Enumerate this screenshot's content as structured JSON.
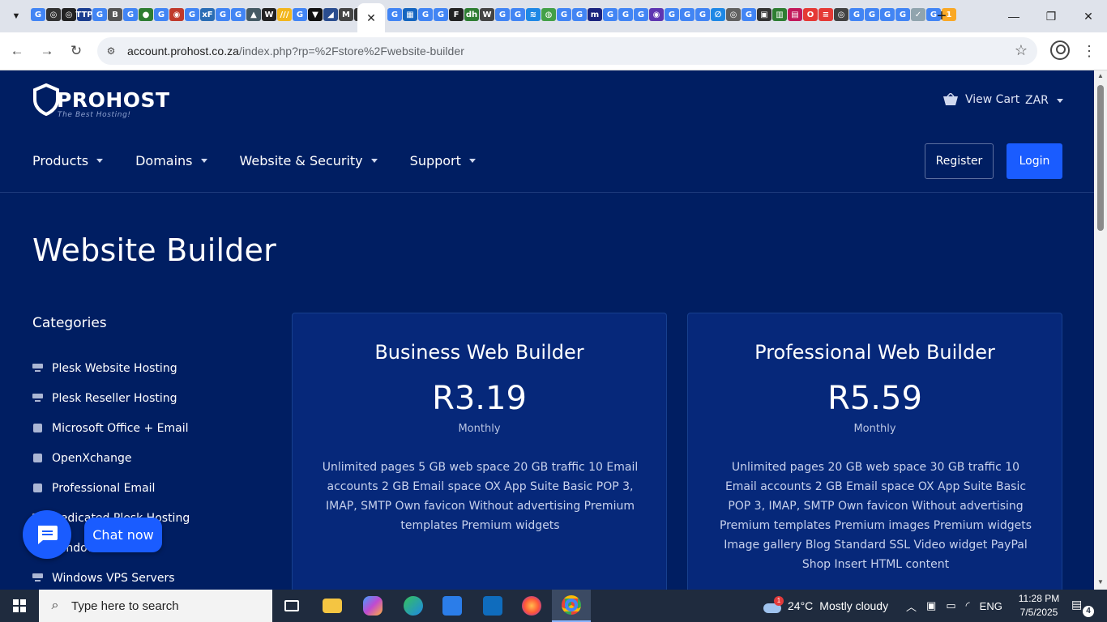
{
  "browser": {
    "url_host": "account.prohost.co.za",
    "url_path": "/index.php?rp=%2Fstore%2Fwebsite-builder",
    "active_tab_close": "✕",
    "new_tab": "+",
    "favicons_left": [
      {
        "label": "G",
        "color": "#4285f4"
      },
      {
        "label": "◎",
        "color": "#333"
      },
      {
        "label": "◎",
        "color": "#222"
      },
      {
        "label": "TTP",
        "color": "#1a3d8f"
      },
      {
        "label": "G",
        "color": "#4285f4"
      },
      {
        "label": "B",
        "color": "#555"
      },
      {
        "label": "G",
        "color": "#4285f4"
      },
      {
        "label": "●",
        "color": "#2e7d32"
      },
      {
        "label": "G",
        "color": "#4285f4"
      },
      {
        "label": "◉",
        "color": "#c0392b"
      },
      {
        "label": "G",
        "color": "#4285f4"
      },
      {
        "label": "xF",
        "color": "#2a6db5"
      },
      {
        "label": "G",
        "color": "#4285f4"
      },
      {
        "label": "G",
        "color": "#4285f4"
      },
      {
        "label": "▲",
        "color": "#455a64"
      },
      {
        "label": "W",
        "color": "#222"
      },
      {
        "label": "///",
        "color": "#f2b61d"
      },
      {
        "label": "G",
        "color": "#4285f4"
      },
      {
        "label": "▼",
        "color": "#111"
      },
      {
        "label": "◢",
        "color": "#2a4d8f"
      },
      {
        "label": "M",
        "color": "#444"
      },
      {
        "label": "◕",
        "color": "#333"
      },
      {
        "label": "e",
        "color": "#6a5acd"
      }
    ],
    "favicons_right": [
      {
        "label": "G",
        "color": "#4285f4"
      },
      {
        "label": "▦",
        "color": "#1565c0"
      },
      {
        "label": "G",
        "color": "#4285f4"
      },
      {
        "label": "G",
        "color": "#4285f4"
      },
      {
        "label": "F",
        "color": "#222"
      },
      {
        "label": "dh",
        "color": "#2e7d32"
      },
      {
        "label": "W",
        "color": "#444"
      },
      {
        "label": "G",
        "color": "#4285f4"
      },
      {
        "label": "G",
        "color": "#4285f4"
      },
      {
        "label": "≋",
        "color": "#1e88e5"
      },
      {
        "label": "◍",
        "color": "#43a047"
      },
      {
        "label": "G",
        "color": "#4285f4"
      },
      {
        "label": "G",
        "color": "#4285f4"
      },
      {
        "label": "m",
        "color": "#1a237e"
      },
      {
        "label": "G",
        "color": "#4285f4"
      },
      {
        "label": "G",
        "color": "#4285f4"
      },
      {
        "label": "G",
        "color": "#4285f4"
      },
      {
        "label": "◉",
        "color": "#5e35b1"
      },
      {
        "label": "G",
        "color": "#4285f4"
      },
      {
        "label": "G",
        "color": "#4285f4"
      },
      {
        "label": "G",
        "color": "#4285f4"
      },
      {
        "label": "∅",
        "color": "#1e88e5"
      },
      {
        "label": "◎",
        "color": "#616161"
      },
      {
        "label": "G",
        "color": "#4285f4"
      },
      {
        "label": "▣",
        "color": "#333"
      },
      {
        "label": "▥",
        "color": "#2e7d32"
      },
      {
        "label": "▤",
        "color": "#c2185b"
      },
      {
        "label": "O",
        "color": "#e53935"
      },
      {
        "label": "≡",
        "color": "#e53935"
      },
      {
        "label": "◎",
        "color": "#424242"
      },
      {
        "label": "G",
        "color": "#4285f4"
      },
      {
        "label": "G",
        "color": "#4285f4"
      },
      {
        "label": "G",
        "color": "#4285f4"
      },
      {
        "label": "G",
        "color": "#4285f4"
      },
      {
        "label": "✓",
        "color": "#90a4ae"
      },
      {
        "label": "G",
        "color": "#4285f4"
      },
      {
        "label": "1",
        "color": "#f9a825"
      }
    ]
  },
  "header": {
    "logo_word": "PROHOST",
    "logo_tagline": "The Best Hosting!",
    "view_cart": "View Cart",
    "currency": "ZAR"
  },
  "nav": {
    "items": [
      "Products",
      "Domains",
      "Website & Security",
      "Support"
    ],
    "register": "Register",
    "login": "Login"
  },
  "main": {
    "title": "Website Builder",
    "categories_heading": "Categories",
    "categories": [
      {
        "label": "Plesk Website Hosting",
        "icon": "server-icon"
      },
      {
        "label": "Plesk Reseller Hosting",
        "icon": "server-icon"
      },
      {
        "label": "Microsoft Office + Email",
        "icon": "box-icon"
      },
      {
        "label": "OpenXchange",
        "icon": "box-icon"
      },
      {
        "label": "Professional Email",
        "icon": "box-icon"
      },
      {
        "label": "Dedicated Plesk Hosting",
        "icon": "server-icon"
      },
      {
        "label": "Windows",
        "icon": "server-icon"
      },
      {
        "label": "Windows VPS Servers",
        "icon": "server-icon"
      }
    ],
    "products": [
      {
        "name": "Business Web Builder",
        "price": "R3.19",
        "cycle": "Monthly",
        "description": "Unlimited pages 5 GB web space 20 GB traffic 10 Email accounts 2 GB Email space OX App Suite Basic POP 3, IMAP, SMTP Own favicon Without advertising Premium templates Premium widgets"
      },
      {
        "name": "Professional Web Builder",
        "price": "R5.59",
        "cycle": "Monthly",
        "description": "Unlimited pages 20 GB web space 30 GB traffic 10 Email accounts 2 GB Email space OX App Suite Basic POP 3, IMAP, SMTP Own favicon Without advertising Premium templates Premium images Premium widgets Image gallery Blog Standard SSL Video widget PayPal Shop Insert HTML content"
      }
    ],
    "chat_label": "Chat now"
  },
  "taskbar": {
    "search_placeholder": "Type here to search",
    "weather_temp": "24°C",
    "weather_text": "Mostly cloudy",
    "weather_badge": "1",
    "language": "ENG",
    "time": "11:28 PM",
    "date": "7/5/2025",
    "notification_count": "4"
  },
  "colors": {
    "page_bg": "#001e62",
    "card_bg": "#06287a",
    "accent": "#1a5cff"
  }
}
